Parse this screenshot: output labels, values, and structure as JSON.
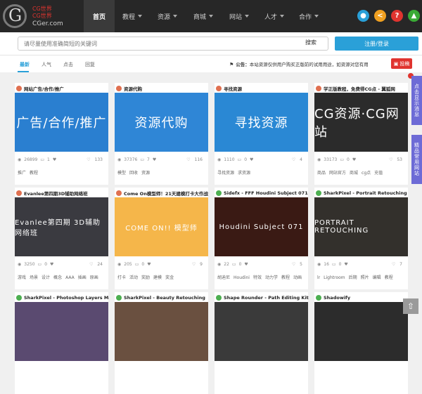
{
  "logo": {
    "line1": "CG世界",
    "line2": "CG世界",
    "site": "CGer.com"
  },
  "nav": [
    {
      "label": "首页",
      "active": true,
      "caret": false,
      "width": 44
    },
    {
      "label": "教程",
      "active": false,
      "caret": true,
      "width": 50
    },
    {
      "label": "资源",
      "active": false,
      "caret": true,
      "width": 50
    },
    {
      "label": "商城",
      "active": false,
      "caret": true,
      "width": 52
    },
    {
      "label": "网站",
      "active": false,
      "caret": true,
      "width": 50
    },
    {
      "label": "人才",
      "active": false,
      "caret": true,
      "width": 50
    },
    {
      "label": "合作",
      "active": false,
      "caret": true,
      "width": 48
    }
  ],
  "top_icons": [
    {
      "name": "fire-icon",
      "glyph": "●",
      "color": "#2aa0d8"
    },
    {
      "name": "share-icon",
      "glyph": "<",
      "color": "#f0a020"
    },
    {
      "name": "help-icon",
      "glyph": "?",
      "color": "#e0342f"
    },
    {
      "name": "user-icon",
      "glyph": "▲",
      "color": "#3aaa35"
    }
  ],
  "search": {
    "placeholder": "请尽量使用准确简短的关键词",
    "button": "搜索",
    "login": "注册/登录"
  },
  "tabs": [
    "最新",
    "人气",
    "点击",
    "回复"
  ],
  "notice": {
    "label": "公告：",
    "text": "本站资源仅供用户购买正版前的试用用途，如资源对您有用"
  },
  "post_button": "投稿",
  "side": {
    "msg": "点击显示消息",
    "sites": "精品常用网站"
  },
  "cards": [
    {
      "title": "网站广告/合作/推广",
      "dot": "#e07050",
      "thumb_text": "广告/合作/推广",
      "thumb_bg": "#2a7fd0",
      "views": "26899",
      "comments": "1",
      "likes": "133",
      "tags": [
        "推广",
        "教程"
      ]
    },
    {
      "title": "资源代购",
      "dot": "#e07050",
      "thumb_text": "资源代购",
      "thumb_bg": "#2f86d6",
      "views": "37376",
      "comments": "7",
      "likes": "116",
      "tags": [
        "模型",
        "回收",
        "资源"
      ]
    },
    {
      "title": "寻找资源",
      "dot": "#e07050",
      "thumb_text": "寻找资源",
      "thumb_bg": "#2a88d4",
      "views": "1110",
      "comments": "0",
      "likes": "4",
      "tags": [
        "寻找资源",
        "求资源"
      ]
    },
    {
      "title": "学正版教程，免费得CG点 - 翼狐网",
      "dot": "#e07050",
      "thumb_text": "CG资源·CG网站",
      "thumb_bg": "#2b2b2b",
      "views": "33173",
      "comments": "0",
      "likes": "53",
      "tags": [
        "商品",
        "网站官方",
        "商城",
        "cg点",
        "充值"
      ]
    },
    {
      "title": "Evanlee第四期3D辅助网络班",
      "dot": "#e07050",
      "thumb_text": "Evanlee第四期 3D辅助网络班",
      "thumb_bg": "#3a3a40",
      "views": "3250",
      "comments": "0",
      "likes": "24",
      "tags": [
        "游戏",
        "场景",
        "设计",
        "概念",
        "AAA",
        "插画",
        "原画"
      ]
    },
    {
      "title": "Come On模型师！21天建模打卡大作战",
      "dot": "#e07050",
      "thumb_text": "COME ON!! 模型师",
      "thumb_bg": "#f5b64a",
      "views": "205",
      "comments": "0",
      "likes": "9",
      "tags": [
        "打卡",
        "活动",
        "奖励",
        "建模",
        "奖金"
      ]
    },
    {
      "title": "Sidefx - FFF Houdini Subject 071",
      "dot": "#4caf50",
      "thumb_text": "Houdini Subject 071",
      "thumb_bg": "#3a1a14",
      "views": "22",
      "comments": "0",
      "likes": "5",
      "tags": [
        "胡迪尼",
        "Houdini",
        "特效",
        "动力学",
        "教程",
        "动画"
      ]
    },
    {
      "title": "SharkPixel - Portrait Retouching",
      "dot": "#4caf50",
      "thumb_text": "PORTRAIT RETOUCHING",
      "thumb_bg": "#33302c",
      "views": "16",
      "comments": "0",
      "likes": "7",
      "tags": [
        "lr",
        "Lightroom",
        "后期",
        "照片",
        "编辑",
        "教程"
      ]
    },
    {
      "title": "SharkPixel - Photoshop Layers Mastercl...",
      "dot": "#4caf50",
      "thumb_text": "",
      "thumb_bg": "#5a4a70",
      "views": "",
      "comments": "",
      "likes": "",
      "tags": []
    },
    {
      "title": "SharkPixel - Beauty Retouching",
      "dot": "#4caf50",
      "thumb_text": "",
      "thumb_bg": "#6a5040",
      "views": "",
      "comments": "",
      "likes": "",
      "tags": []
    },
    {
      "title": "Shape Rounder - Path Editing Kit",
      "dot": "#4caf50",
      "thumb_text": "",
      "thumb_bg": "#3a3a3a",
      "views": "",
      "comments": "",
      "likes": "",
      "tags": []
    },
    {
      "title": "Shadowify",
      "dot": "#4caf50",
      "thumb_text": "",
      "thumb_bg": "#2c2c2c",
      "views": "",
      "comments": "",
      "likes": "",
      "tags": []
    }
  ]
}
